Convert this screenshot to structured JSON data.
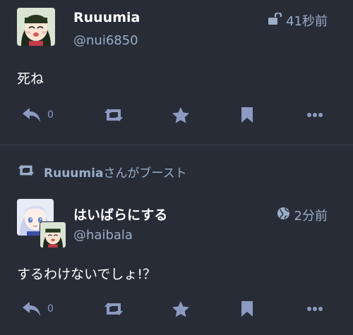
{
  "statuses": [
    {
      "display_name": "Ruuumia",
      "acct": "@nui6850",
      "visibility_icon": "unlock-icon",
      "time": "41秒前",
      "content": "死ね",
      "reply_count": "0"
    },
    {
      "boost": {
        "by": "Ruuumia",
        "suffix": "さんがブースト"
      },
      "display_name": "はいばらにする",
      "acct": "@haibala",
      "visibility_icon": "globe-icon",
      "time": "2分前",
      "content": "するわけないでしょ!？",
      "reply_count": "0"
    }
  ],
  "colors": {
    "background": "#282c37",
    "muted_text": "#9baec8",
    "action_icon": "#8d9ac2",
    "separator": "#393f4f"
  }
}
